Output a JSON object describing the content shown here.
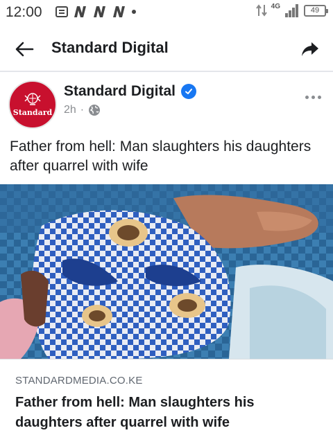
{
  "status_bar": {
    "time": "12:00",
    "network": "4G",
    "battery": "49",
    "notification_icons": [
      "message-icon",
      "n-notification-icon",
      "n-notification-icon",
      "n-notification-icon",
      "dot-icon"
    ]
  },
  "header": {
    "title": "Standard Digital",
    "back_icon": "arrow-left-icon",
    "share_icon": "share-arrow-icon"
  },
  "post": {
    "page_name": "Standard Digital",
    "verified": true,
    "avatar_text": "Standard",
    "time": "2h",
    "separator": "·",
    "audience_icon": "globe-icon",
    "text": "Father from hell: Man slaughters his daughters after quarrel with wife"
  },
  "link_preview": {
    "domain": "STANDARDMEDIA.CO.KE",
    "title": "Father from hell: Man slaughters his daughters after quarrel with wife"
  },
  "colors": {
    "brand_red": "#c8102e",
    "verified_blue": "#1877f2",
    "muted_text": "#8a8d91"
  }
}
